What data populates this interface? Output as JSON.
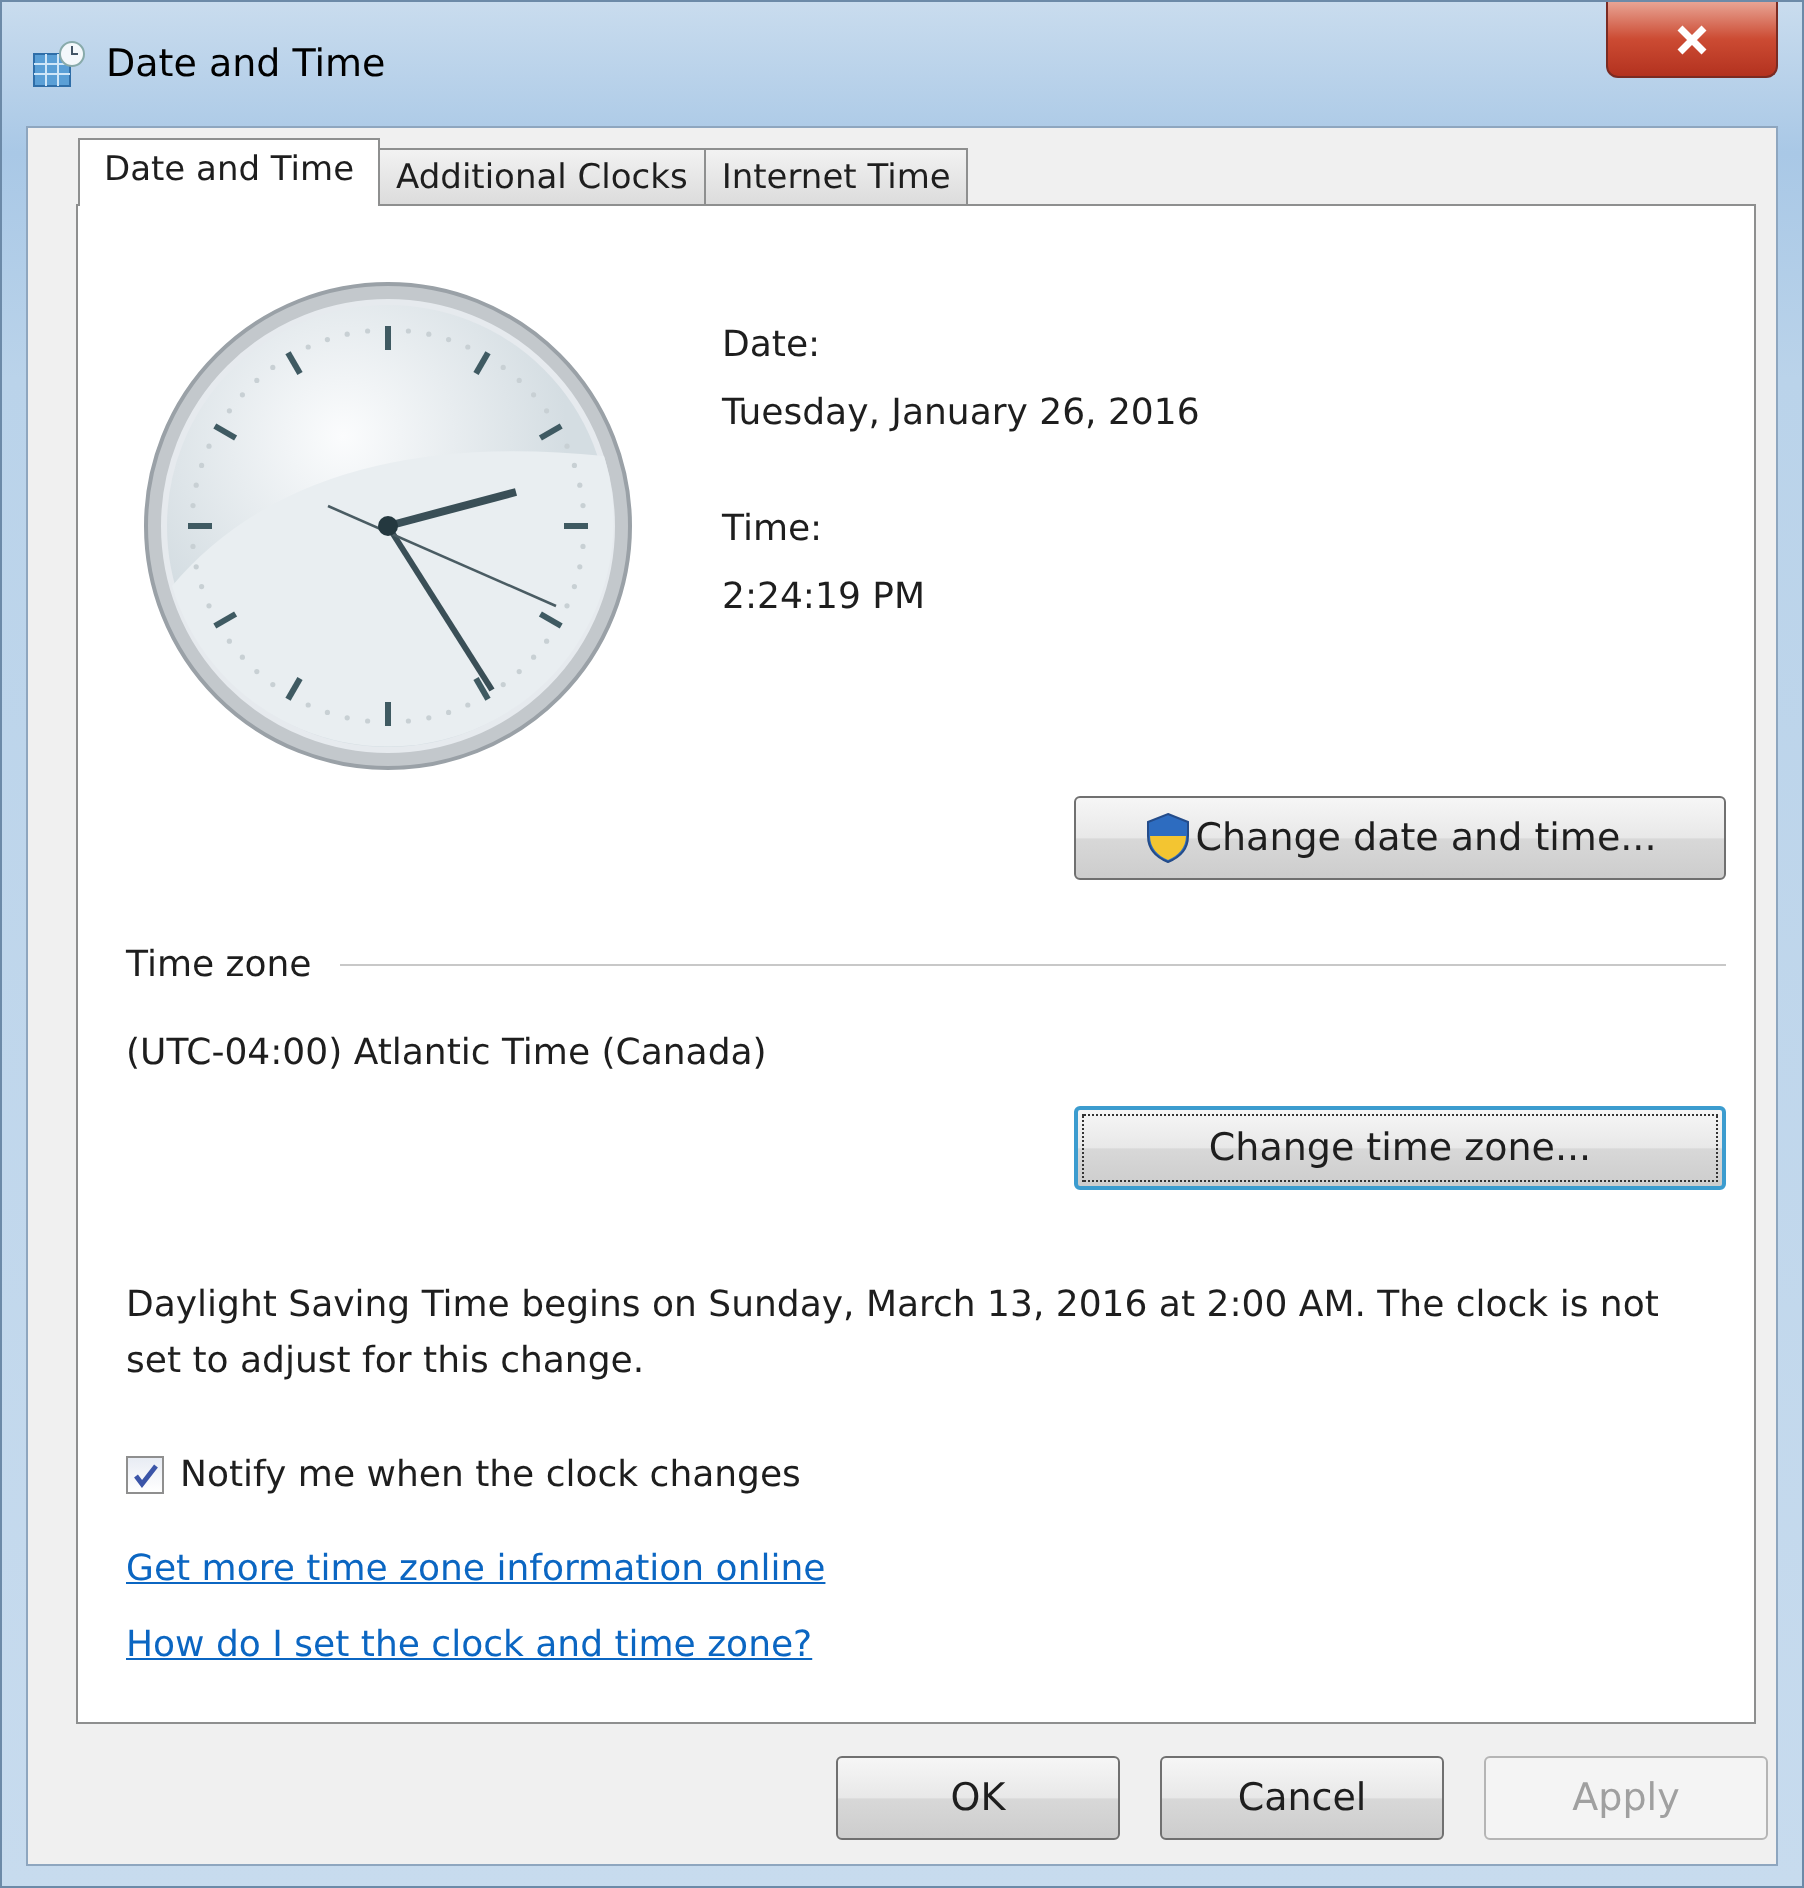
{
  "window": {
    "title": "Date and Time"
  },
  "tabs": [
    {
      "label": "Date and Time",
      "selected": true
    },
    {
      "label": "Additional Clocks",
      "selected": false
    },
    {
      "label": "Internet Time",
      "selected": false
    }
  ],
  "date": {
    "label": "Date:",
    "value": "Tuesday, January 26, 2016"
  },
  "time": {
    "label": "Time:",
    "value": "2:24:19 PM"
  },
  "change_date_button": {
    "label": "Change date and time...",
    "focused": false
  },
  "time_zone": {
    "heading": "Time zone",
    "value": "(UTC-04:00) Atlantic Time (Canada)"
  },
  "change_zone_button": {
    "label": "Change time zone...",
    "focused": true
  },
  "dst_note": "Daylight Saving Time begins on Sunday, March 13, 2016 at 2:00 AM. The clock is not set to adjust for this change.",
  "notify": {
    "label": "Notify me when the clock changes",
    "checked": true
  },
  "links": [
    "Get more time zone information online",
    "How do I set the clock and time zone?"
  ],
  "buttons": [
    {
      "label": "OK",
      "disabled": false
    },
    {
      "label": "Cancel",
      "disabled": false
    },
    {
      "label": "Apply",
      "disabled": true
    }
  ]
}
